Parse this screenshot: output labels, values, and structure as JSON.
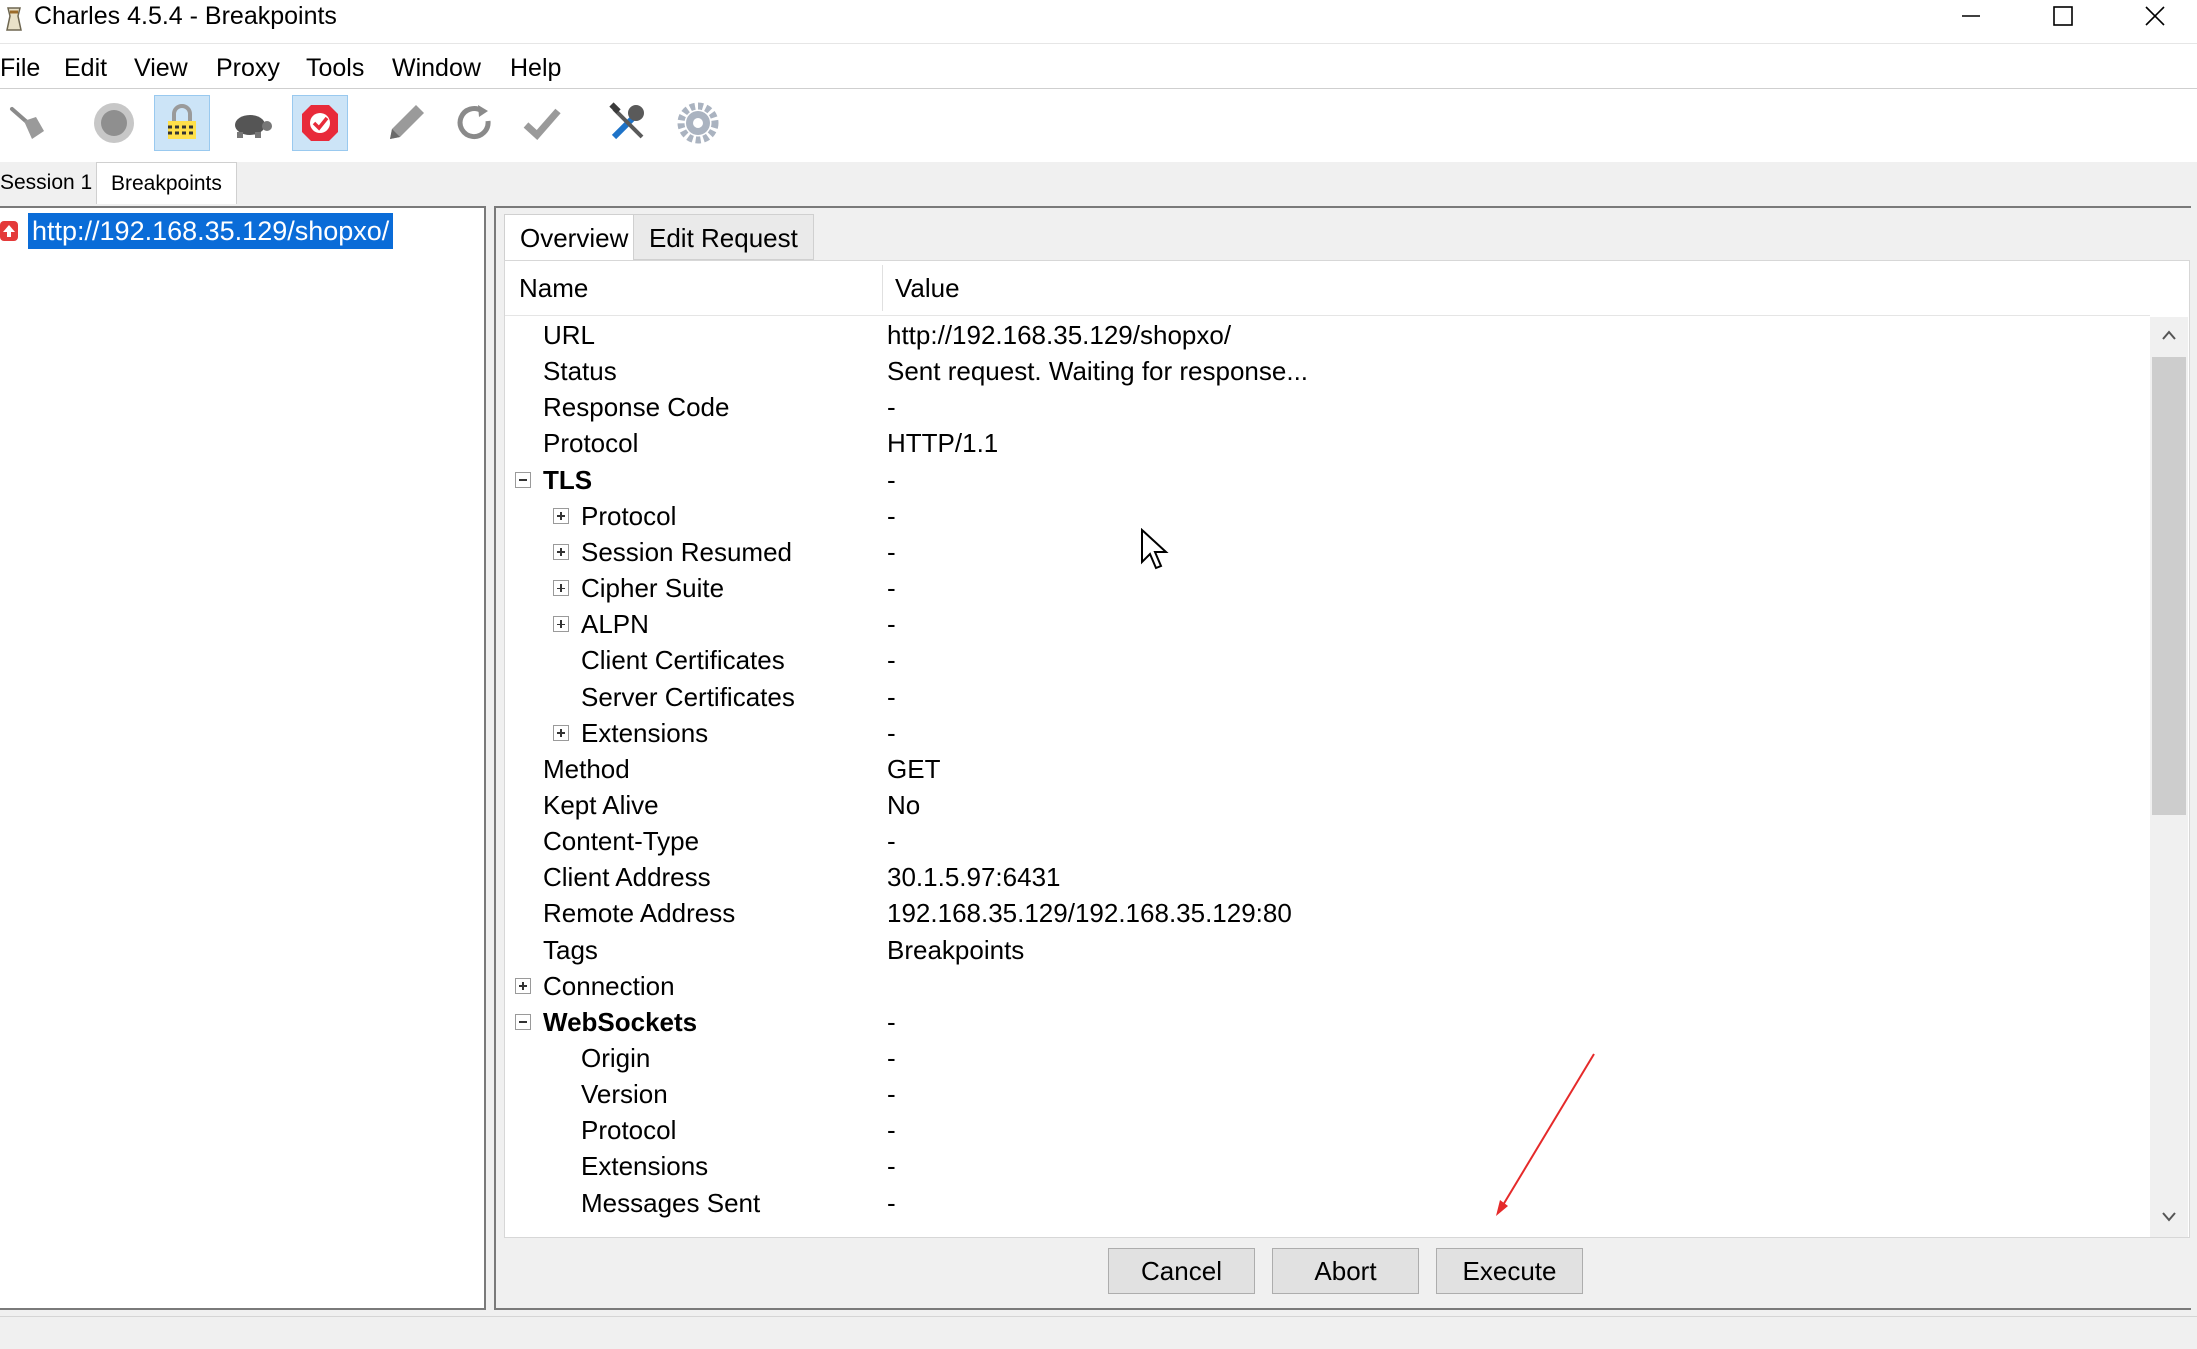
{
  "window": {
    "title": "Charles 4.5.4 - Breakpoints"
  },
  "menu": [
    "File",
    "Edit",
    "View",
    "Proxy",
    "Tools",
    "Window",
    "Help"
  ],
  "toolbar": {
    "tools": [
      {
        "name": "broom-icon",
        "active": false
      },
      {
        "name": "record-icon",
        "active": false
      },
      {
        "name": "ssl-proxy-icon",
        "active": true
      },
      {
        "name": "throttle-turtle-icon",
        "active": false
      },
      {
        "name": "breakpoint-icon",
        "active": true
      },
      {
        "name": "compose-pen-icon",
        "active": false
      },
      {
        "name": "repeat-icon",
        "active": false
      },
      {
        "name": "validate-check-icon",
        "active": false
      },
      {
        "name": "tools-icon",
        "active": false
      },
      {
        "name": "settings-gear-icon",
        "active": false
      }
    ]
  },
  "session_tabs": [
    "Session 1",
    "Breakpoints"
  ],
  "breakpoint_list": {
    "item": "http://192.168.35.129/shopxo/"
  },
  "detail_tabs": [
    "Overview",
    "Edit Request"
  ],
  "grid": {
    "col_name": "Name",
    "col_value": "Value",
    "rows": [
      {
        "name": "URL",
        "value": "http://192.168.35.129/shopxo/",
        "level": 1,
        "expander": "",
        "bold": false
      },
      {
        "name": "Status",
        "value": "Sent request. Waiting for response...",
        "level": 1,
        "expander": "",
        "bold": false
      },
      {
        "name": "Response Code",
        "value": "-",
        "level": 1,
        "expander": "",
        "bold": false
      },
      {
        "name": "Protocol",
        "value": "HTTP/1.1",
        "level": 1,
        "expander": "",
        "bold": false
      },
      {
        "name": "TLS",
        "value": "-",
        "level": 1,
        "expander": "minus",
        "bold": true
      },
      {
        "name": "Protocol",
        "value": "-",
        "level": 2,
        "expander": "plus",
        "bold": false
      },
      {
        "name": "Session Resumed",
        "value": "-",
        "level": 2,
        "expander": "plus",
        "bold": false
      },
      {
        "name": "Cipher Suite",
        "value": "-",
        "level": 2,
        "expander": "plus",
        "bold": false
      },
      {
        "name": "ALPN",
        "value": "-",
        "level": 2,
        "expander": "plus",
        "bold": false
      },
      {
        "name": "Client Certificates",
        "value": "-",
        "level": 2,
        "expander": "",
        "bold": false
      },
      {
        "name": "Server Certificates",
        "value": "-",
        "level": 2,
        "expander": "",
        "bold": false
      },
      {
        "name": "Extensions",
        "value": "-",
        "level": 2,
        "expander": "plus",
        "bold": false
      },
      {
        "name": "Method",
        "value": "GET",
        "level": 1,
        "expander": "",
        "bold": false
      },
      {
        "name": "Kept Alive",
        "value": "No",
        "level": 1,
        "expander": "",
        "bold": false
      },
      {
        "name": "Content-Type",
        "value": "-",
        "level": 1,
        "expander": "",
        "bold": false
      },
      {
        "name": "Client Address",
        "value": "30.1.5.97:6431",
        "level": 1,
        "expander": "",
        "bold": false
      },
      {
        "name": "Remote Address",
        "value": "192.168.35.129/192.168.35.129:80",
        "level": 1,
        "expander": "",
        "bold": false
      },
      {
        "name": "Tags",
        "value": "Breakpoints",
        "level": 1,
        "expander": "",
        "bold": false
      },
      {
        "name": "Connection",
        "value": "",
        "level": 1,
        "expander": "plus",
        "bold": false
      },
      {
        "name": "WebSockets",
        "value": "-",
        "level": 1,
        "expander": "minus",
        "bold": true
      },
      {
        "name": "Origin",
        "value": "-",
        "level": 2,
        "expander": "",
        "bold": false
      },
      {
        "name": "Version",
        "value": "-",
        "level": 2,
        "expander": "",
        "bold": false
      },
      {
        "name": "Protocol",
        "value": "-",
        "level": 2,
        "expander": "",
        "bold": false
      },
      {
        "name": "Extensions",
        "value": "-",
        "level": 2,
        "expander": "",
        "bold": false
      },
      {
        "name": "Messages Sent",
        "value": "-",
        "level": 2,
        "expander": "",
        "bold": false
      }
    ]
  },
  "actions": {
    "cancel": "Cancel",
    "abort": "Abort",
    "execute": "Execute"
  }
}
